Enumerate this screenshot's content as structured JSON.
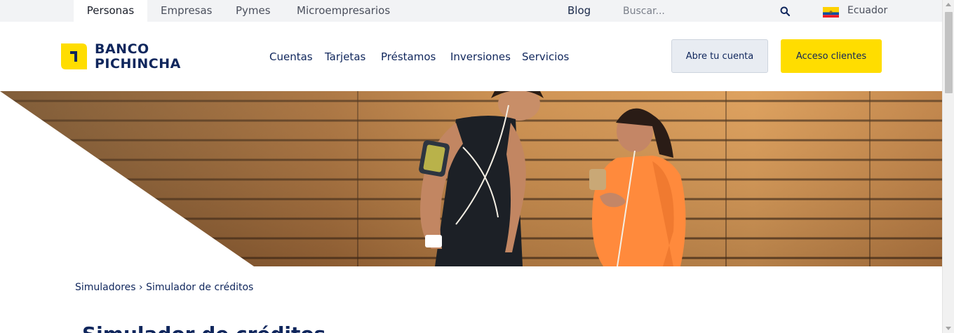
{
  "topbar": {
    "segments": [
      {
        "label": "Personas",
        "active": true
      },
      {
        "label": "Empresas",
        "active": false
      },
      {
        "label": "Pymes",
        "active": false
      },
      {
        "label": "Microempresarios",
        "active": false
      }
    ],
    "blog_label": "Blog",
    "search_placeholder": "Buscar...",
    "search_icon": "search-icon",
    "flag_icon": "ecuador-flag-icon",
    "country_label": "Ecuador"
  },
  "header": {
    "logo_line1": "BANCO",
    "logo_line2": "PICHINCHA",
    "nav": [
      "Cuentas",
      "Tarjetas",
      "Préstamos",
      "Inversiones",
      "Servicios"
    ],
    "open_account_label": "Abre tu cuenta",
    "client_access_label": "Acceso clientes"
  },
  "breadcrumb": {
    "parent": "Simuladores",
    "separator": "›",
    "current": "Simulador de créditos"
  },
  "page_title": "Simulador de créditos",
  "colors": {
    "brand_navy": "#0f265c",
    "brand_yellow": "#ffdd00",
    "topbar_bg": "#f2f3f5",
    "secondary_button_bg": "#e8ecf2"
  }
}
